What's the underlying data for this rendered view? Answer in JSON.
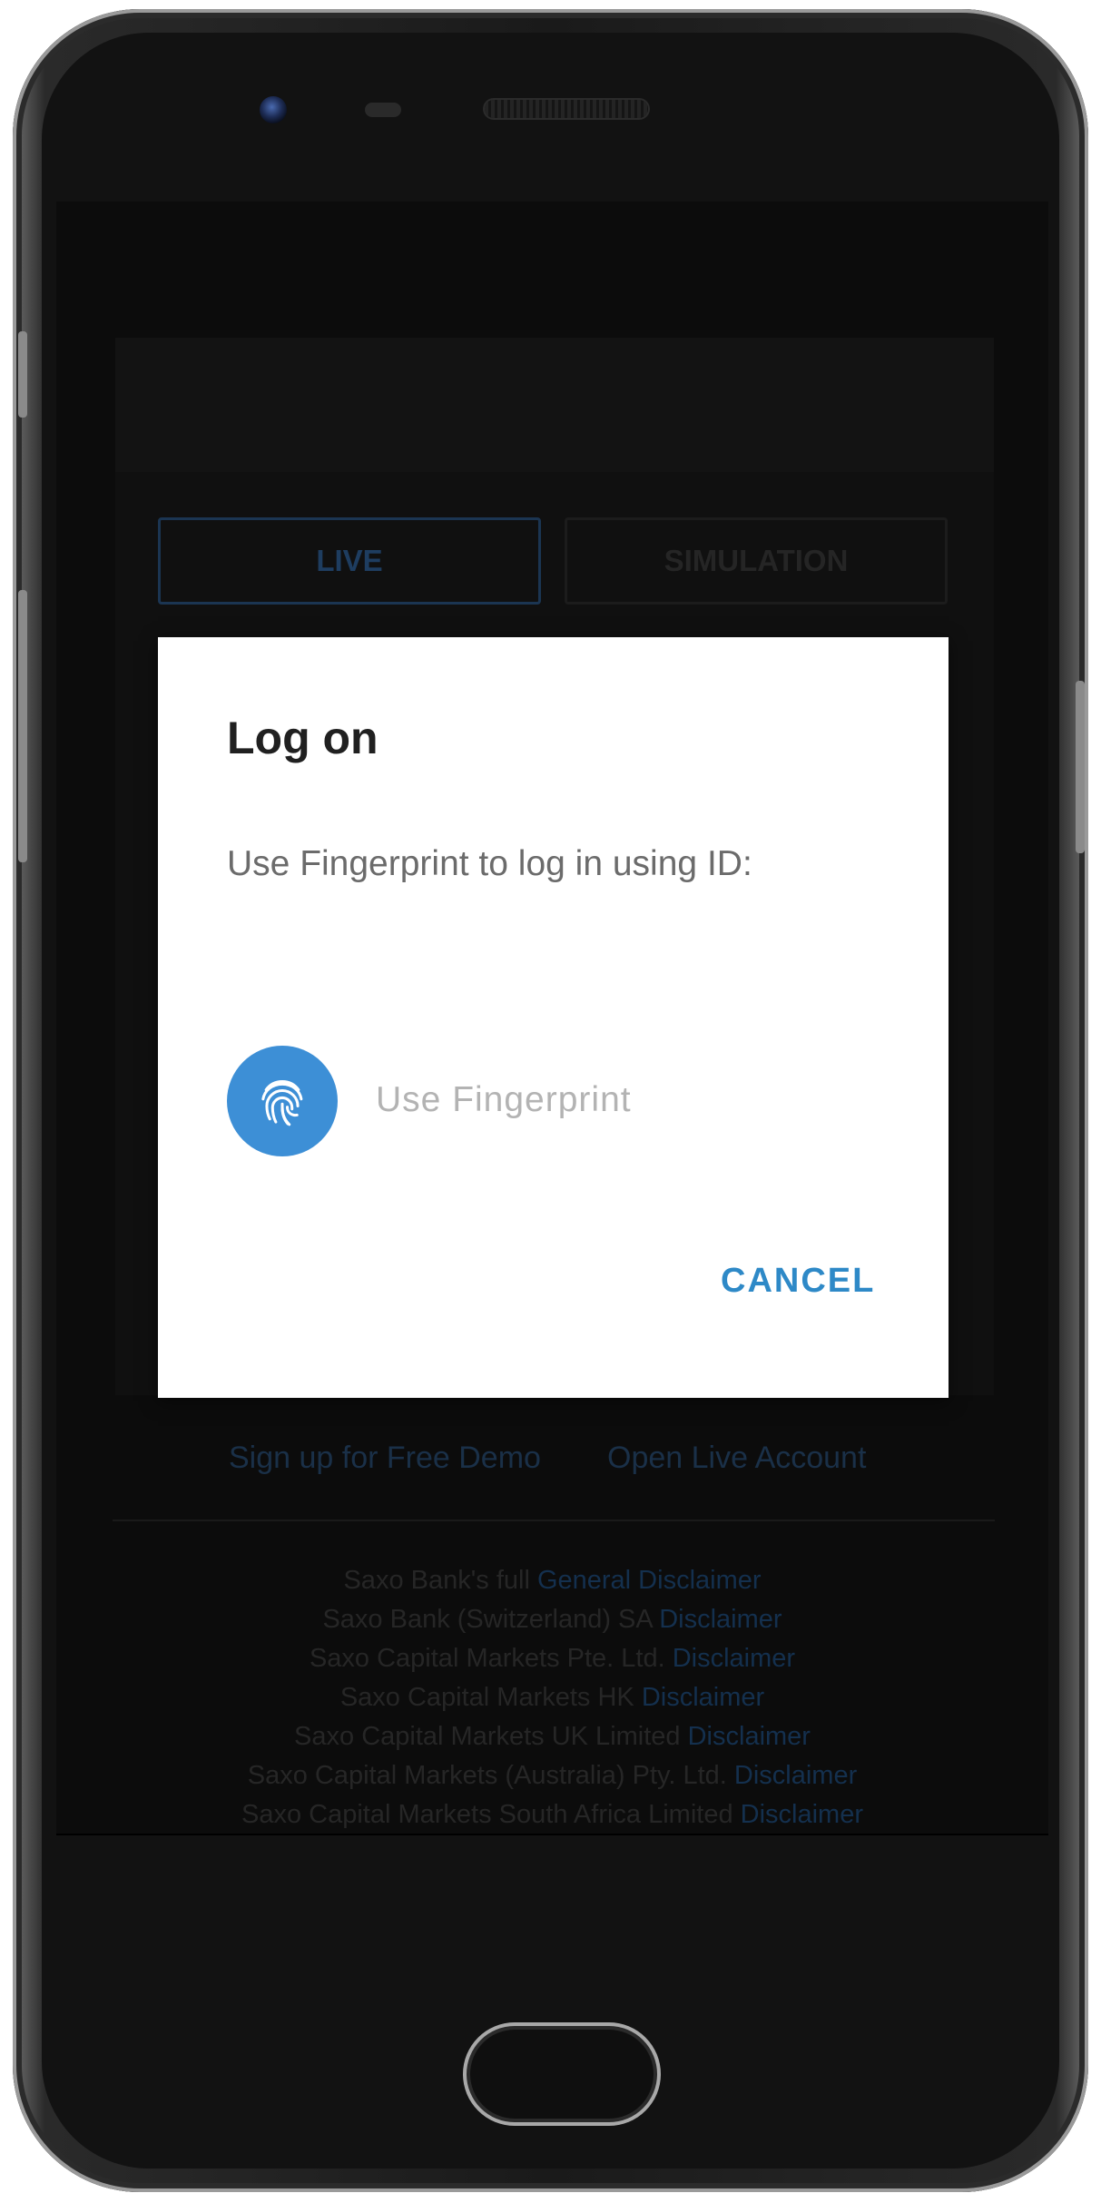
{
  "app": {
    "tabs": [
      {
        "label": "LIVE",
        "active": true
      },
      {
        "label": "SIMULATION",
        "active": false
      }
    ],
    "links": {
      "signup_demo": "Sign up for Free Demo",
      "open_live": "Open Live Account"
    },
    "disclaimers": [
      {
        "text": "Saxo Bank's full ",
        "link": "General Disclaimer"
      },
      {
        "text": "Saxo Bank (Switzerland) SA ",
        "link": "Disclaimer"
      },
      {
        "text": "Saxo Capital Markets Pte. Ltd. ",
        "link": "Disclaimer"
      },
      {
        "text": "Saxo Capital Markets HK ",
        "link": "Disclaimer"
      },
      {
        "text": "Saxo Capital Markets UK Limited ",
        "link": "Disclaimer"
      },
      {
        "text": "Saxo Capital Markets (Australia) Pty. Ltd. ",
        "link": "Disclaimer"
      },
      {
        "text": "Saxo Capital Markets South Africa Limited ",
        "link": "Disclaimer"
      }
    ]
  },
  "dialog": {
    "title": "Log on",
    "message": "Use Fingerprint to log in using ID:",
    "fingerprint_label": "Use Fingerprint",
    "fingerprint_icon": "fingerprint-icon",
    "cancel_label": "CANCEL"
  },
  "colors": {
    "accent": "#2e89c7",
    "fingerprint_bg": "#3d8fd6"
  },
  "navbar": {
    "back_icon": "back-triangle-icon",
    "home_icon": "home-circle-icon",
    "recents_icon": "recents-square-icon"
  }
}
